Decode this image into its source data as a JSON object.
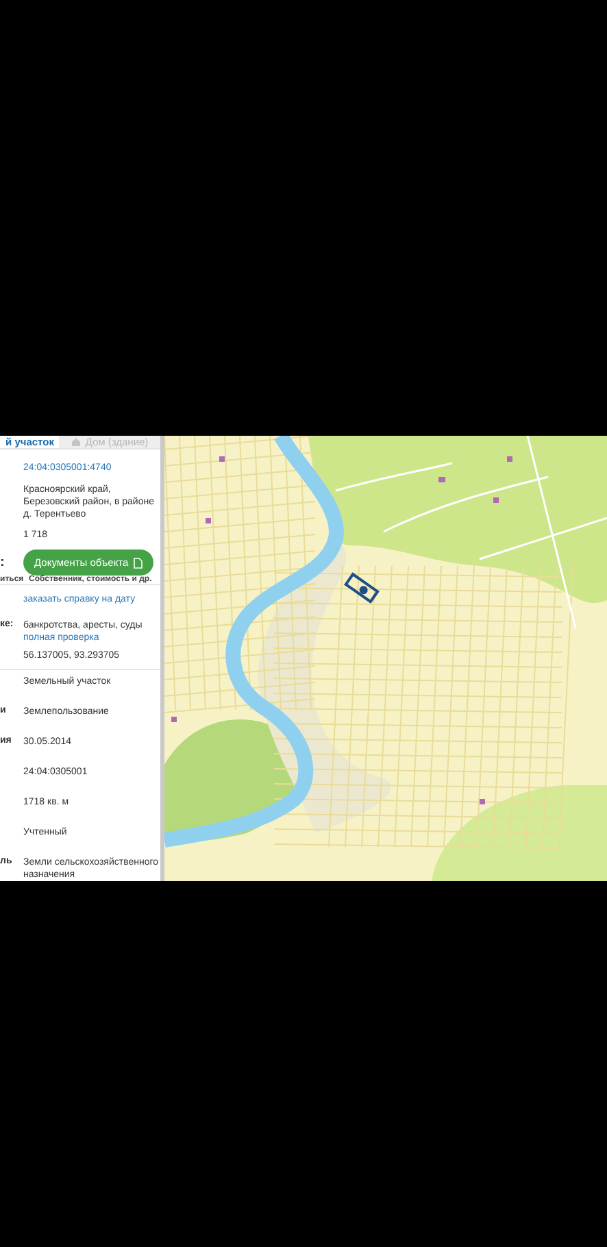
{
  "tabs": [
    {
      "label": "й участок",
      "selected": true,
      "disabled": false
    },
    {
      "label": "Дом (здание)",
      "selected": false,
      "disabled": true
    }
  ],
  "cadastral_number": "24:04:0305001:4740",
  "address": "Красноярский край, Березовский район, в районе д. Терентьево",
  "area": "1 718",
  "actions": {
    "left_mark": ":",
    "left_caption": "иться",
    "documents_button": "Документы объекта",
    "documents_caption": "Собственник, стоимость и др."
  },
  "order_link": "заказать справку на дату",
  "fields": [
    {
      "label": "ке:",
      "value": "банкротства, аресты, суды",
      "link": "полная проверка"
    },
    {
      "value": "56.137005, 93.293705",
      "divider": true
    },
    {
      "value": "Земельный участок"
    },
    {
      "label": "и",
      "value": "Землепользование"
    },
    {
      "label": "ия",
      "value": "30.05.2014"
    },
    {
      "value": "24:04:0305001"
    },
    {
      "value": "1718 кв. м"
    },
    {
      "value": "Учтенный"
    },
    {
      "label": "ль",
      "value": "Земли сельскохозяйственного назначения"
    }
  ]
}
